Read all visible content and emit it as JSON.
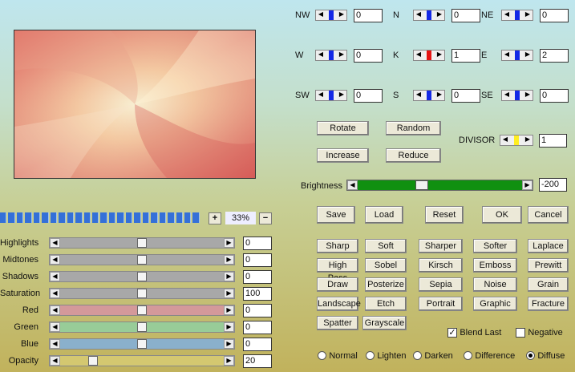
{
  "progress": {
    "zoom_label": "33%",
    "plus": "+",
    "minus": "−",
    "segments": 24
  },
  "sliders": [
    {
      "label": "Highlights",
      "value": "0",
      "level": 0.5,
      "color": "#a8a8a8"
    },
    {
      "label": "Midtones",
      "value": "0",
      "level": 0.5,
      "color": "#a8a8a8"
    },
    {
      "label": "Shadows",
      "value": "0",
      "level": 0.5,
      "color": "#a8a8a8"
    },
    {
      "label": "Saturation",
      "value": "100",
      "level": 0.5,
      "color": "#a8a8a8"
    },
    {
      "label": "Red",
      "value": "0",
      "level": 0.5,
      "color": "#d4999a"
    },
    {
      "label": "Green",
      "value": "0",
      "level": 0.5,
      "color": "#98cc98"
    },
    {
      "label": "Blue",
      "value": "0",
      "level": 0.5,
      "color": "#8ab0cc"
    },
    {
      "label": "Opacity",
      "value": "20",
      "level": 0.2,
      "color": "#d4c870"
    }
  ],
  "matrix": [
    {
      "label": "NW",
      "value": "0",
      "color": "#1428e6"
    },
    {
      "label": "N",
      "value": "0",
      "color": "#1428e6"
    },
    {
      "label": "NE",
      "value": "0",
      "color": "#1428e6"
    },
    {
      "label": "W",
      "value": "0",
      "color": "#1428e6"
    },
    {
      "label": "K",
      "value": "1",
      "color": "#e61414"
    },
    {
      "label": "E",
      "value": "2",
      "color": "#1428e6"
    },
    {
      "label": "SW",
      "value": "0",
      "color": "#1428e6"
    },
    {
      "label": "S",
      "value": "0",
      "color": "#1428e6"
    },
    {
      "label": "SE",
      "value": "0",
      "color": "#1428e6"
    }
  ],
  "buttons": {
    "rotate": "Rotate",
    "random": "Random",
    "increase": "Increase",
    "reduce": "Reduce",
    "save": "Save",
    "load": "Load",
    "reset": "Reset",
    "ok": "OK",
    "cancel": "Cancel"
  },
  "divisor": {
    "label": "DIVISOR",
    "value": "1"
  },
  "brightness": {
    "label": "Brightness",
    "value": "-200",
    "level": 0.5
  },
  "presets": [
    [
      "Sharp",
      "Soft",
      "Sharper",
      "Softer",
      "Laplace"
    ],
    [
      "High Pass",
      "Sobel",
      "Kirsch",
      "Emboss",
      "Prewitt"
    ],
    [
      "Draw",
      "Posterize",
      "Sepia",
      "Noise",
      "Grain"
    ],
    [
      "Landscape",
      "Etch",
      "Portrait",
      "Graphic",
      "Fracture"
    ],
    [
      "Spatter",
      "Grayscale"
    ]
  ],
  "options": {
    "blend_last": "Blend Last",
    "negative": "Negative"
  },
  "modes": {
    "normal": "Normal",
    "lighten": "Lighten",
    "darken": "Darken",
    "difference": "Difference",
    "diffuse": "Diffuse"
  }
}
